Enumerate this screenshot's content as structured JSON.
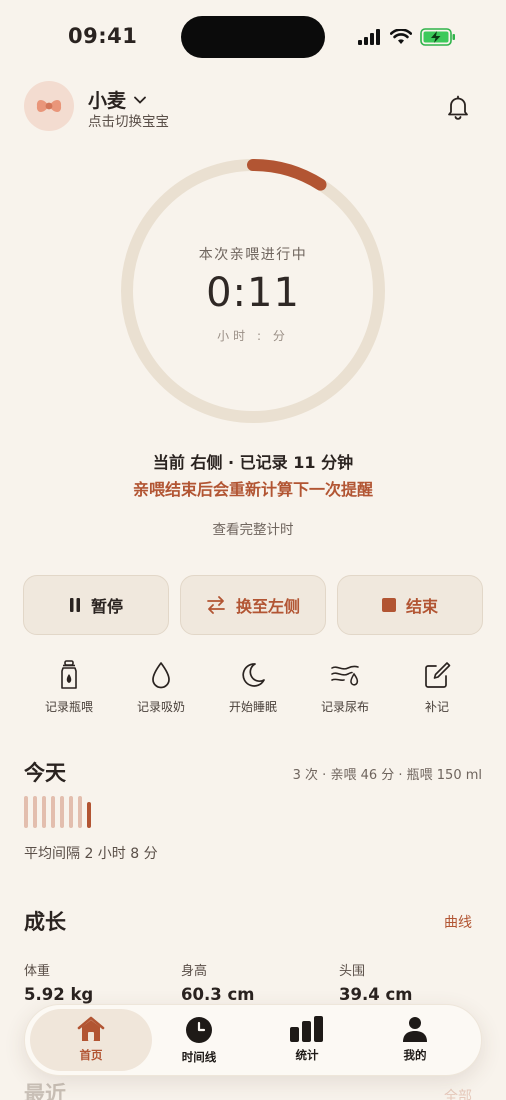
{
  "status": {
    "time": "09:41"
  },
  "header": {
    "baby_name": "小麦",
    "switch_hint": "点击切换宝宝"
  },
  "timer": {
    "label": "本次亲喂进行中",
    "value": "0:11",
    "unit": "小时 : 分",
    "progress_fraction": 0.09
  },
  "info": {
    "current_side": "当前 右侧 · 已记录 11 分钟",
    "reminder_note": "亲喂结束后会重新计算下一次提醒",
    "view_full": "查看完整计时"
  },
  "actions": {
    "pause": "暂停",
    "switch_side": "换至左侧",
    "end": "结束"
  },
  "quick_actions": [
    {
      "label": "记录瓶喂",
      "icon": "bottle-icon"
    },
    {
      "label": "记录吸奶",
      "icon": "droplet-icon"
    },
    {
      "label": "开始睡眠",
      "icon": "moon-icon"
    },
    {
      "label": "记录尿布",
      "icon": "diaper-icon"
    },
    {
      "label": "补记",
      "icon": "edit-icon"
    }
  ],
  "today": {
    "title": "今天",
    "stats": "3 次 · 亲喂 46 分 · 瓶喂 150 ml",
    "interval": "平均间隔 2 小时 8 分"
  },
  "growth": {
    "title": "成长",
    "curve_link": "曲线",
    "items": [
      {
        "label": "体重",
        "value": "5.92 kg"
      },
      {
        "label": "身高",
        "value": "60.3 cm"
      },
      {
        "label": "头围",
        "value": "39.4 cm"
      }
    ]
  },
  "recent": {
    "title": "最近",
    "all_link": "全部"
  },
  "tabs": [
    {
      "label": "首页",
      "icon": "home-icon",
      "active": true
    },
    {
      "label": "时间线",
      "icon": "clock-icon",
      "active": false
    },
    {
      "label": "统计",
      "icon": "bar-chart-icon",
      "active": false
    },
    {
      "label": "我的",
      "icon": "person-icon",
      "active": false
    }
  ],
  "colors": {
    "background": "#F8F3EC",
    "accent": "#B25533",
    "ring_track": "#EAE0D1"
  }
}
